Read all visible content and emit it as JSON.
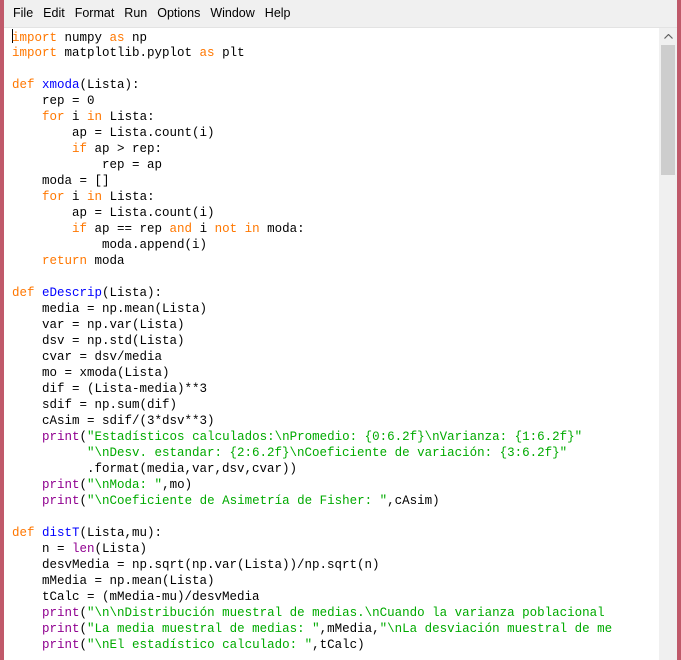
{
  "menu": [
    "File",
    "Edit",
    "Format",
    "Run",
    "Options",
    "Window",
    "Help"
  ],
  "code_lines": [
    [
      [
        "kw",
        "import"
      ],
      [
        "n",
        " numpy "
      ],
      [
        "kw",
        "as"
      ],
      [
        "n",
        " np"
      ]
    ],
    [
      [
        "kw",
        "import"
      ],
      [
        "n",
        " matplotlib.pyplot "
      ],
      [
        "kw",
        "as"
      ],
      [
        "n",
        " plt"
      ]
    ],
    [],
    [
      [
        "kw",
        "def"
      ],
      [
        "n",
        " "
      ],
      [
        "fn",
        "xmoda"
      ],
      [
        "n",
        "(Lista):"
      ]
    ],
    [
      [
        "n",
        "    rep = 0"
      ]
    ],
    [
      [
        "n",
        "    "
      ],
      [
        "kw",
        "for"
      ],
      [
        "n",
        " i "
      ],
      [
        "kw",
        "in"
      ],
      [
        "n",
        " Lista:"
      ]
    ],
    [
      [
        "n",
        "        ap = Lista.count(i)"
      ]
    ],
    [
      [
        "n",
        "        "
      ],
      [
        "kw",
        "if"
      ],
      [
        "n",
        " ap > rep:"
      ]
    ],
    [
      [
        "n",
        "            rep = ap"
      ]
    ],
    [
      [
        "n",
        "    moda = []"
      ]
    ],
    [
      [
        "n",
        "    "
      ],
      [
        "kw",
        "for"
      ],
      [
        "n",
        " i "
      ],
      [
        "kw",
        "in"
      ],
      [
        "n",
        " Lista:"
      ]
    ],
    [
      [
        "n",
        "        ap = Lista.count(i)"
      ]
    ],
    [
      [
        "n",
        "        "
      ],
      [
        "kw",
        "if"
      ],
      [
        "n",
        " ap == rep "
      ],
      [
        "kw",
        "and"
      ],
      [
        "n",
        " i "
      ],
      [
        "kw",
        "not in"
      ],
      [
        "n",
        " moda:"
      ]
    ],
    [
      [
        "n",
        "            moda.append(i)"
      ]
    ],
    [
      [
        "n",
        "    "
      ],
      [
        "kw",
        "return"
      ],
      [
        "n",
        " moda"
      ]
    ],
    [],
    [
      [
        "kw",
        "def"
      ],
      [
        "n",
        " "
      ],
      [
        "fn",
        "eDescrip"
      ],
      [
        "n",
        "(Lista):"
      ]
    ],
    [
      [
        "n",
        "    media = np.mean(Lista)"
      ]
    ],
    [
      [
        "n",
        "    var = np.var(Lista)"
      ]
    ],
    [
      [
        "n",
        "    dsv = np.std(Lista)"
      ]
    ],
    [
      [
        "n",
        "    cvar = dsv/media"
      ]
    ],
    [
      [
        "n",
        "    mo = xmoda(Lista)"
      ]
    ],
    [
      [
        "n",
        "    dif = (Lista-media)**3"
      ]
    ],
    [
      [
        "n",
        "    sdif = np.sum(dif)"
      ]
    ],
    [
      [
        "n",
        "    cAsim = sdif/(3*dsv**3)"
      ]
    ],
    [
      [
        "n",
        "    "
      ],
      [
        "bi",
        "print"
      ],
      [
        "n",
        "("
      ],
      [
        "st",
        "\"Estadísticos calculados:\\nPromedio: {0:6.2f}\\nVarianza: {1:6.2f}\""
      ]
    ],
    [
      [
        "n",
        "          "
      ],
      [
        "st",
        "\"\\nDesv. estandar: {2:6.2f}\\nCoeficiente de variación: {3:6.2f}\""
      ]
    ],
    [
      [
        "n",
        "          .format(media,var,dsv,cvar))"
      ]
    ],
    [
      [
        "n",
        "    "
      ],
      [
        "bi",
        "print"
      ],
      [
        "n",
        "("
      ],
      [
        "st",
        "\"\\nModa: \""
      ],
      [
        "n",
        ",mo)"
      ]
    ],
    [
      [
        "n",
        "    "
      ],
      [
        "bi",
        "print"
      ],
      [
        "n",
        "("
      ],
      [
        "st",
        "\"\\nCoeficiente de Asimetría de Fisher: \""
      ],
      [
        "n",
        ",cAsim)"
      ]
    ],
    [],
    [
      [
        "kw",
        "def"
      ],
      [
        "n",
        " "
      ],
      [
        "fn",
        "distT"
      ],
      [
        "n",
        "(Lista,mu):"
      ]
    ],
    [
      [
        "n",
        "    n = "
      ],
      [
        "bi",
        "len"
      ],
      [
        "n",
        "(Lista)"
      ]
    ],
    [
      [
        "n",
        "    desvMedia = np.sqrt(np.var(Lista))/np.sqrt(n)"
      ]
    ],
    [
      [
        "n",
        "    mMedia = np.mean(Lista)"
      ]
    ],
    [
      [
        "n",
        "    tCalc = (mMedia-mu)/desvMedia"
      ]
    ],
    [
      [
        "n",
        "    "
      ],
      [
        "bi",
        "print"
      ],
      [
        "n",
        "("
      ],
      [
        "st",
        "\"\\n\\nDistribución muestral de medias.\\nCuando la varianza poblacional"
      ]
    ],
    [
      [
        "n",
        "    "
      ],
      [
        "bi",
        "print"
      ],
      [
        "n",
        "("
      ],
      [
        "st",
        "\"La media muestral de medias: \""
      ],
      [
        "n",
        ",mMedia,"
      ],
      [
        "st",
        "\"\\nLa desviación muestral de me"
      ]
    ],
    [
      [
        "n",
        "    "
      ],
      [
        "bi",
        "print"
      ],
      [
        "n",
        "("
      ],
      [
        "st",
        "\"\\nEl estadístico calculado: \""
      ],
      [
        "n",
        ",tCalc)"
      ]
    ]
  ],
  "colors": {
    "keyword": "#ff7700",
    "function_name": "#0000ff",
    "string": "#00aa00",
    "builtin": "#900090",
    "text": "#000000",
    "desktop": "#c0596a"
  },
  "icons": {
    "scroll_up": "triangle-up-icon"
  }
}
